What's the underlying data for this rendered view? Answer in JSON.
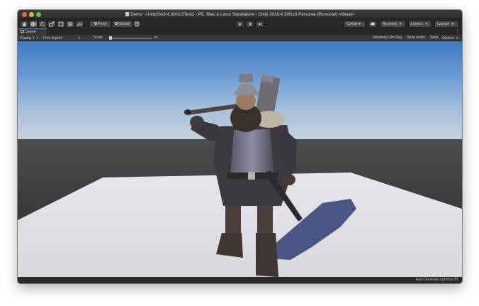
{
  "window": {
    "title": "Demo - Unity2019.4.30f1c3Test2 - PC, Mac & Linux Standalone - Unity 2019.4.30f1c3 Personal (Personal) <Metal>"
  },
  "toolbar": {
    "tools": [
      {
        "name": "hand-tool",
        "icon": "hand-icon"
      },
      {
        "name": "move-tool",
        "icon": "move-icon"
      },
      {
        "name": "rotate-tool",
        "icon": "rotate-icon"
      },
      {
        "name": "scale-tool",
        "icon": "scale-icon"
      },
      {
        "name": "rect-tool",
        "icon": "rect-icon"
      },
      {
        "name": "transform-tool",
        "icon": "transform-icon"
      },
      {
        "name": "custom-tool",
        "icon": "wrench-icon"
      }
    ],
    "pivot_label": "Pivot",
    "global_label": "Global",
    "collab_label": "Collab ▾",
    "account_label": "Account",
    "layers_label": "Layers",
    "layout_label": "Layout"
  },
  "tabs": {
    "game_label": "Game"
  },
  "game_view": {
    "display_label": "Display 1",
    "aspect_label": "Free Aspect",
    "scale_label": "Scale",
    "scale_value": "1x",
    "scale_level": 0.0,
    "maximize_label": "Maximize On Play",
    "mute_label": "Mute Audio",
    "stats_label": "Stats",
    "gizmos_label": "Gizmos"
  },
  "status": {
    "text": "Auto Generate Lighting Off"
  },
  "colors": {
    "active_tab_accent": "#5b8ad6",
    "sky_top": "#3f79c2",
    "plane": "#e4e3e8"
  }
}
